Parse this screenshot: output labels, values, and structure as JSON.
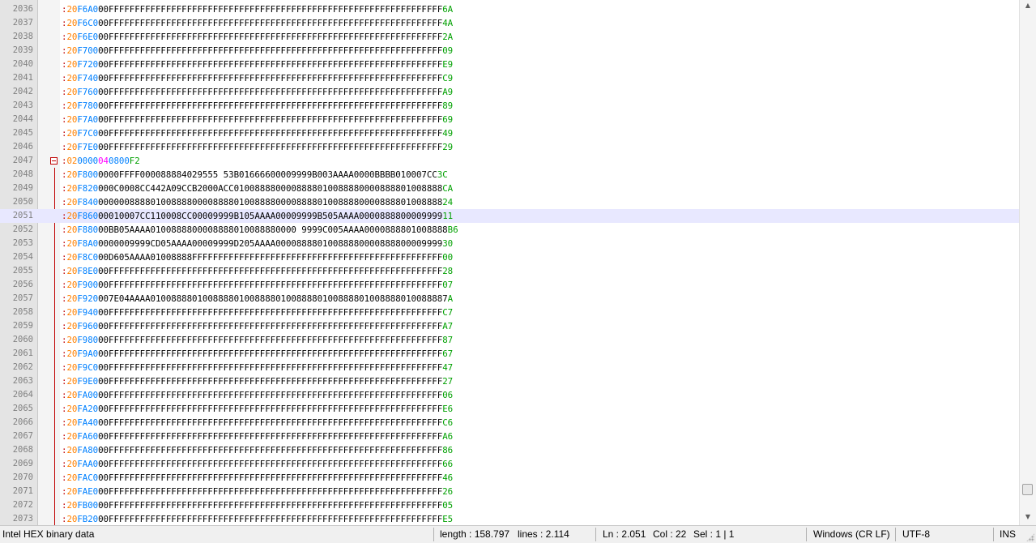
{
  "editor": {
    "lines": [
      {
        "num": "2036",
        "len": "20",
        "addr": "F6A0",
        "type": "00",
        "data": "FFFFFFFFFFFFFFFFFFFFFFFFFFFFFFFFFFFFFFFFFFFFFFFFFFFFFFFFFFFFFFFF",
        "sum": "6A"
      },
      {
        "num": "2037",
        "len": "20",
        "addr": "F6C0",
        "type": "00",
        "data": "FFFFFFFFFFFFFFFFFFFFFFFFFFFFFFFFFFFFFFFFFFFFFFFFFFFFFFFFFFFFFFFF",
        "sum": "4A"
      },
      {
        "num": "2038",
        "len": "20",
        "addr": "F6E0",
        "type": "00",
        "data": "FFFFFFFFFFFFFFFFFFFFFFFFFFFFFFFFFFFFFFFFFFFFFFFFFFFFFFFFFFFFFFFF",
        "sum": "2A"
      },
      {
        "num": "2039",
        "len": "20",
        "addr": "F700",
        "type": "00",
        "data": "FFFFFFFFFFFFFFFFFFFFFFFFFFFFFFFFFFFFFFFFFFFFFFFFFFFFFFFFFFFFFFFF",
        "sum": "09"
      },
      {
        "num": "2040",
        "len": "20",
        "addr": "F720",
        "type": "00",
        "data": "FFFFFFFFFFFFFFFFFFFFFFFFFFFFFFFFFFFFFFFFFFFFFFFFFFFFFFFFFFFFFFFF",
        "sum": "E9"
      },
      {
        "num": "2041",
        "len": "20",
        "addr": "F740",
        "type": "00",
        "data": "FFFFFFFFFFFFFFFFFFFFFFFFFFFFFFFFFFFFFFFFFFFFFFFFFFFFFFFFFFFFFFFF",
        "sum": "C9"
      },
      {
        "num": "2042",
        "len": "20",
        "addr": "F760",
        "type": "00",
        "data": "FFFFFFFFFFFFFFFFFFFFFFFFFFFFFFFFFFFFFFFFFFFFFFFFFFFFFFFFFFFFFFFF",
        "sum": "A9"
      },
      {
        "num": "2043",
        "len": "20",
        "addr": "F780",
        "type": "00",
        "data": "FFFFFFFFFFFFFFFFFFFFFFFFFFFFFFFFFFFFFFFFFFFFFFFFFFFFFFFFFFFFFFFF",
        "sum": "89"
      },
      {
        "num": "2044",
        "len": "20",
        "addr": "F7A0",
        "type": "00",
        "data": "FFFFFFFFFFFFFFFFFFFFFFFFFFFFFFFFFFFFFFFFFFFFFFFFFFFFFFFFFFFFFFFF",
        "sum": "69"
      },
      {
        "num": "2045",
        "len": "20",
        "addr": "F7C0",
        "type": "00",
        "data": "FFFFFFFFFFFFFFFFFFFFFFFFFFFFFFFFFFFFFFFFFFFFFFFFFFFFFFFFFFFFFFFF",
        "sum": "49"
      },
      {
        "num": "2046",
        "len": "20",
        "addr": "F7E0",
        "type": "00",
        "data": "FFFFFFFFFFFFFFFFFFFFFFFFFFFFFFFFFFFFFFFFFFFFFFFFFFFFFFFFFFFFFFFF",
        "sum": "29"
      },
      {
        "num": "2047",
        "len": "02",
        "addr": "0000",
        "type": "04",
        "data": "0800",
        "sum": "F2",
        "special": true
      },
      {
        "num": "2048",
        "len": "20",
        "addr": "F800",
        "type": "00",
        "data": "00FFFF000088884029555 53B01666600009999B003AAAA0000BBBB010007CC",
        "sum": "3C"
      },
      {
        "num": "2049",
        "len": "20",
        "addr": "F820",
        "type": "00",
        "data": "0C0008CC442A09CCB2000ACC0100888800008888010088880000888801008888",
        "sum": "CA"
      },
      {
        "num": "2050",
        "len": "20",
        "addr": "F840",
        "type": "00",
        "data": "0000888801008888000088880100888800008888010088880000888801008888",
        "sum": "24"
      },
      {
        "num": "2051",
        "len": "20",
        "addr": "F860",
        "type": "00",
        "data": "010007CC110008CC00009999B105AAAA00009999B505AAAA0000888800009999",
        "sum": "11",
        "current": true
      },
      {
        "num": "2052",
        "len": "20",
        "addr": "F880",
        "type": "00",
        "data": "BB05AAAA0100888800008888010088880000 9999C005AAAA0000888801008888",
        "sum": "B6"
      },
      {
        "num": "2053",
        "len": "20",
        "addr": "F8A0",
        "type": "00",
        "data": "00009999CD05AAAA00009999D205AAAA00008888010088880000888800009999",
        "sum": "30"
      },
      {
        "num": "2054",
        "len": "20",
        "addr": "F8C0",
        "type": "00",
        "data": "D605AAAA01008888FFFFFFFFFFFFFFFFFFFFFFFFFFFFFFFFFFFFFFFFFFFFFFFF",
        "sum": "00"
      },
      {
        "num": "2055",
        "len": "20",
        "addr": "F8E0",
        "type": "00",
        "data": "FFFFFFFFFFFFFFFFFFFFFFFFFFFFFFFFFFFFFFFFFFFFFFFFFFFFFFFFFFFFFFFF",
        "sum": "28"
      },
      {
        "num": "2056",
        "len": "20",
        "addr": "F900",
        "type": "00",
        "data": "FFFFFFFFFFFFFFFFFFFFFFFFFFFFFFFFFFFFFFFFFFFFFFFFFFFFFFFFFFFFFFFF",
        "sum": "07"
      },
      {
        "num": "2057",
        "len": "20",
        "addr": "F920",
        "type": "00",
        "data": "7E04AAAA010088880100888801008888010088880100888801008888010088887",
        "sum": "A"
      },
      {
        "num": "2058",
        "len": "20",
        "addr": "F940",
        "type": "00",
        "data": "FFFFFFFFFFFFFFFFFFFFFFFFFFFFFFFFFFFFFFFFFFFFFFFFFFFFFFFFFFFFFFFF",
        "sum": "C7"
      },
      {
        "num": "2059",
        "len": "20",
        "addr": "F960",
        "type": "00",
        "data": "FFFFFFFFFFFFFFFFFFFFFFFFFFFFFFFFFFFFFFFFFFFFFFFFFFFFFFFFFFFFFFFF",
        "sum": "A7"
      },
      {
        "num": "2060",
        "len": "20",
        "addr": "F980",
        "type": "00",
        "data": "FFFFFFFFFFFFFFFFFFFFFFFFFFFFFFFFFFFFFFFFFFFFFFFFFFFFFFFFFFFFFFFF",
        "sum": "87"
      },
      {
        "num": "2061",
        "len": "20",
        "addr": "F9A0",
        "type": "00",
        "data": "FFFFFFFFFFFFFFFFFFFFFFFFFFFFFFFFFFFFFFFFFFFFFFFFFFFFFFFFFFFFFFFF",
        "sum": "67"
      },
      {
        "num": "2062",
        "len": "20",
        "addr": "F9C0",
        "type": "00",
        "data": "FFFFFFFFFFFFFFFFFFFFFFFFFFFFFFFFFFFFFFFFFFFFFFFFFFFFFFFFFFFFFFFF",
        "sum": "47"
      },
      {
        "num": "2063",
        "len": "20",
        "addr": "F9E0",
        "type": "00",
        "data": "FFFFFFFFFFFFFFFFFFFFFFFFFFFFFFFFFFFFFFFFFFFFFFFFFFFFFFFFFFFFFFFF",
        "sum": "27"
      },
      {
        "num": "2064",
        "len": "20",
        "addr": "FA00",
        "type": "00",
        "data": "FFFFFFFFFFFFFFFFFFFFFFFFFFFFFFFFFFFFFFFFFFFFFFFFFFFFFFFFFFFFFFFF",
        "sum": "06"
      },
      {
        "num": "2065",
        "len": "20",
        "addr": "FA20",
        "type": "00",
        "data": "FFFFFFFFFFFFFFFFFFFFFFFFFFFFFFFFFFFFFFFFFFFFFFFFFFFFFFFFFFFFFFFF",
        "sum": "E6"
      },
      {
        "num": "2066",
        "len": "20",
        "addr": "FA40",
        "type": "00",
        "data": "FFFFFFFFFFFFFFFFFFFFFFFFFFFFFFFFFFFFFFFFFFFFFFFFFFFFFFFFFFFFFFFF",
        "sum": "C6"
      },
      {
        "num": "2067",
        "len": "20",
        "addr": "FA60",
        "type": "00",
        "data": "FFFFFFFFFFFFFFFFFFFFFFFFFFFFFFFFFFFFFFFFFFFFFFFFFFFFFFFFFFFFFFFF",
        "sum": "A6"
      },
      {
        "num": "2068",
        "len": "20",
        "addr": "FA80",
        "type": "00",
        "data": "FFFFFFFFFFFFFFFFFFFFFFFFFFFFFFFFFFFFFFFFFFFFFFFFFFFFFFFFFFFFFFFF",
        "sum": "86"
      },
      {
        "num": "2069",
        "len": "20",
        "addr": "FAA0",
        "type": "00",
        "data": "FFFFFFFFFFFFFFFFFFFFFFFFFFFFFFFFFFFFFFFFFFFFFFFFFFFFFFFFFFFFFFFF",
        "sum": "66"
      },
      {
        "num": "2070",
        "len": "20",
        "addr": "FAC0",
        "type": "00",
        "data": "FFFFFFFFFFFFFFFFFFFFFFFFFFFFFFFFFFFFFFFFFFFFFFFFFFFFFFFFFFFFFFFF",
        "sum": "46"
      },
      {
        "num": "2071",
        "len": "20",
        "addr": "FAE0",
        "type": "00",
        "data": "FFFFFFFFFFFFFFFFFFFFFFFFFFFFFFFFFFFFFFFFFFFFFFFFFFFFFFFFFFFFFFFF",
        "sum": "26"
      },
      {
        "num": "2072",
        "len": "20",
        "addr": "FB00",
        "type": "00",
        "data": "FFFFFFFFFFFFFFFFFFFFFFFFFFFFFFFFFFFFFFFFFFFFFFFFFFFFFFFFFFFFFFFF",
        "sum": "05"
      },
      {
        "num": "2073",
        "len": "20",
        "addr": "FB20",
        "type": "00",
        "data": "FFFFFFFFFFFFFFFFFFFFFFFFFFFFFFFFFFFFFFFFFFFFFFFFFFFFFFFFFFFFFFFF",
        "sum": "E5"
      }
    ]
  },
  "statusbar": {
    "file_type": "Intel HEX binary data",
    "length": "length : 158.797",
    "lines": "lines : 2.114",
    "ln": "Ln : 2.051",
    "col": "Col : 22",
    "sel": "Sel : 1 | 1",
    "eol": "Windows (CR LF)",
    "encoding": "UTF-8",
    "mode": "INS"
  },
  "colors": {
    "colon": "#c00000",
    "byte_count": "#ff8000",
    "address": "#0080ff",
    "checksum": "#00a000",
    "current_line": "#e8e8ff"
  }
}
